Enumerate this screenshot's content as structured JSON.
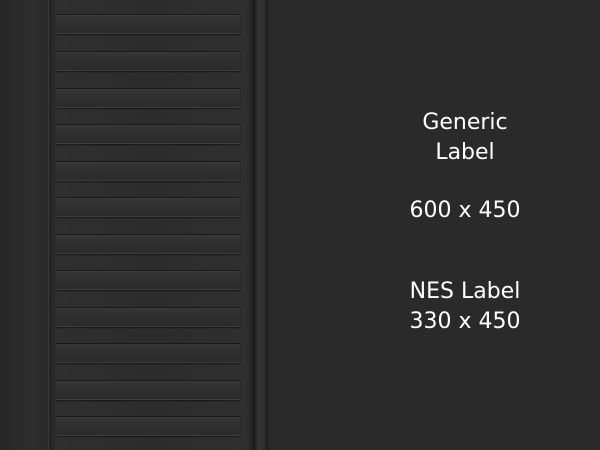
{
  "generic_label": {
    "line1": "Generic",
    "line2": "Label",
    "dimensions": "600 x 450"
  },
  "nes_label": {
    "title": "NES Label",
    "dimensions": "330 x 450"
  },
  "colors": {
    "background": "#2a2a2a",
    "text": "#ffffff",
    "ridge": "#303030"
  }
}
